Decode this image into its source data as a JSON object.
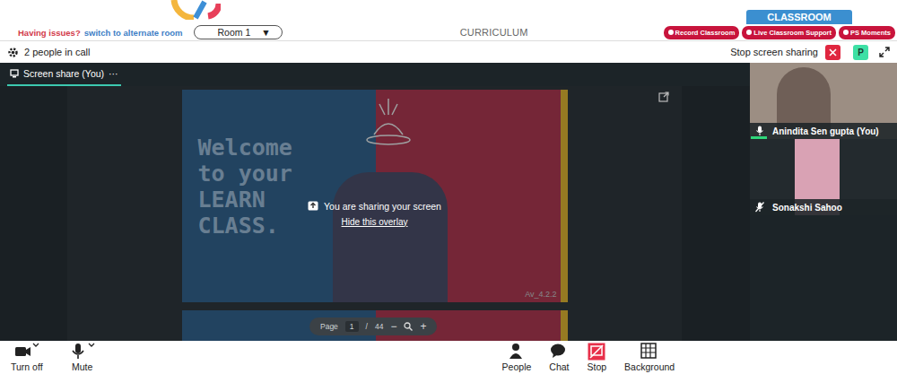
{
  "header": {
    "issue_text": "Having issues?",
    "switch_link": "switch to alternate room",
    "room_select": "Room 1",
    "room_arrow": "▼",
    "title": "CURRICULUM",
    "classroom_tab": "CLASSROOM",
    "actions": [
      {
        "label": "Record Classroom"
      },
      {
        "label": "Live Classroom Support"
      },
      {
        "label": "PS Moments"
      }
    ]
  },
  "call_bar": {
    "people_count": "2 people in call",
    "stop_share": "Stop screen sharing",
    "avatar": "P"
  },
  "stage": {
    "tabs": [
      {
        "label": "Screen share (You)",
        "selected": true
      }
    ],
    "more": "···",
    "slide": {
      "lines": [
        "Welcome",
        "to your",
        "LEARN",
        "CLASS."
      ],
      "version": "Av_4.2.2"
    },
    "overlay": {
      "message": "You are sharing your screen",
      "hide_link": "Hide this overlay"
    },
    "pager": {
      "label": "Page",
      "current": "1",
      "separator": "/",
      "total": "44",
      "zoom_out": "−",
      "zoom_in": "+"
    }
  },
  "participants": [
    {
      "name": "Anindita Sen gupta (You)",
      "muted": false,
      "speaking": true
    },
    {
      "name": "Sonakshi Sahoo",
      "muted": true,
      "speaking": false
    }
  ],
  "toolbar": [
    {
      "label": "Turn off",
      "kind": "camera",
      "has_menu": true,
      "active": false
    },
    {
      "label": "Mute",
      "kind": "mic",
      "has_menu": true,
      "active": false
    },
    {
      "label": "People",
      "kind": "people",
      "has_menu": false,
      "active": false
    },
    {
      "label": "Chat",
      "kind": "chat",
      "has_menu": false,
      "active": false
    },
    {
      "label": "Stop",
      "kind": "stop",
      "has_menu": false,
      "active": true
    },
    {
      "label": "Background",
      "kind": "background",
      "has_menu": false,
      "active": false
    }
  ]
}
